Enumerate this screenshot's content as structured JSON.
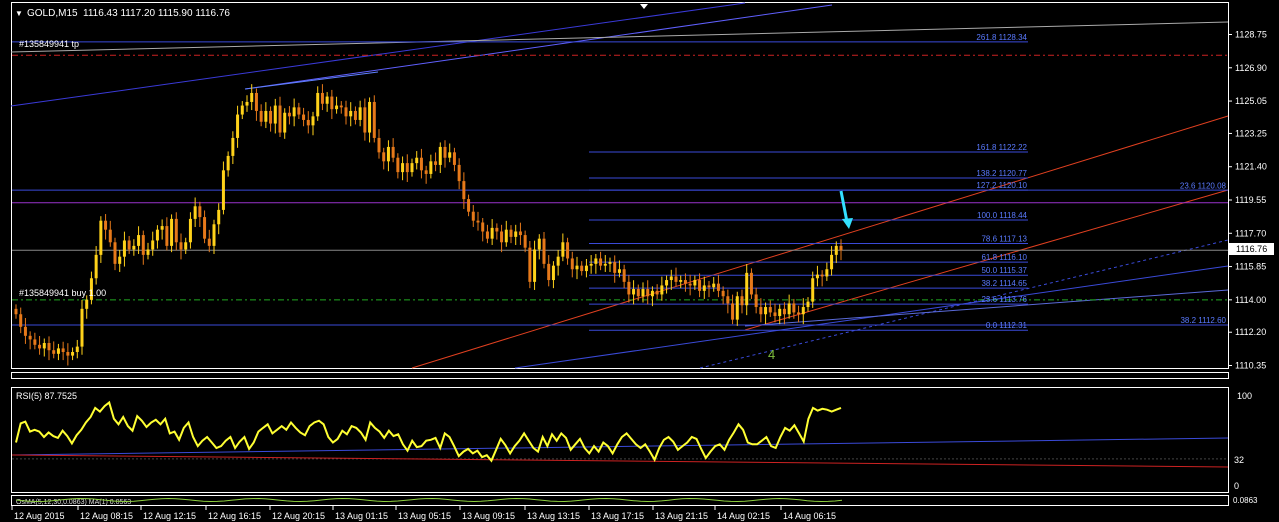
{
  "chart_data": [
    {
      "type": "candlestick",
      "symbol_label": "GOLD,M15",
      "ohlc_label": "1116.43 1117.20 1115.90 1116.76",
      "current_price_label": "1116.76",
      "ylim": [
        1110.35,
        1130.5
      ],
      "price_ticks": [
        "1128.75",
        "1126.90",
        "1125.05",
        "1123.25",
        "1121.40",
        "1119.55",
        "1117.70",
        "1115.85",
        "1114.00",
        "1112.20",
        "1110.35"
      ],
      "orders": [
        {
          "label": "#135849941 tp",
          "price": 1127.6,
          "color": "#cc2222"
        },
        {
          "label": "#135849941 buy 1.00",
          "price": 1114.0,
          "color": "#22aa22"
        }
      ],
      "fib_levels": [
        {
          "label": "261.8 1128.34",
          "price": 1128.34
        },
        {
          "label": "161.8 1122.22",
          "price": 1122.22
        },
        {
          "label": "138.2 1120.77",
          "price": 1120.77
        },
        {
          "label": "127.2 1120.10",
          "price": 1120.1
        },
        {
          "label": "100.0 1118.44",
          "price": 1118.44
        },
        {
          "label": "78.6 1117.13",
          "price": 1117.13
        },
        {
          "label": "61.8 1116.10",
          "price": 1116.1
        },
        {
          "label": "50.0 1115.37",
          "price": 1115.37
        },
        {
          "label": "38.2 1114.65",
          "price": 1114.65
        },
        {
          "label": "23.6 1113.76",
          "price": 1113.76
        },
        {
          "label": "0.0 1112.31",
          "price": 1112.31
        }
      ],
      "right_fib_labels": [
        {
          "label": "23.6 1120.08",
          "price": 1120.08
        },
        {
          "label": "38.2 1112.60",
          "price": 1112.6
        }
      ],
      "wave_label": "4",
      "closes": [
        1113.2,
        1112.5,
        1112.0,
        1111.8,
        1111.5,
        1111.3,
        1111.6,
        1111.2,
        1111.0,
        1111.3,
        1111.1,
        1110.9,
        1111.1,
        1111.4,
        1113.5,
        1114.0,
        1115.2,
        1116.5,
        1118.4,
        1117.9,
        1117.2,
        1116.0,
        1116.4,
        1117.3,
        1116.8,
        1117.0,
        1117.6,
        1116.5,
        1116.8,
        1117.3,
        1117.9,
        1118.1,
        1117.0,
        1118.5,
        1117.2,
        1116.8,
        1117.2,
        1118.5,
        1119.2,
        1118.6,
        1117.4,
        1117.0,
        1118.2,
        1119.0,
        1121.2,
        1122.0,
        1123.0,
        1124.3,
        1124.8,
        1125.0,
        1125.5,
        1124.5,
        1123.9,
        1124.5,
        1123.8,
        1124.8,
        1123.3,
        1124.4,
        1124.2,
        1124.7,
        1124.3,
        1124.0,
        1123.7,
        1124.2,
        1125.5,
        1124.9,
        1125.3,
        1124.6,
        1124.8,
        1124.7,
        1124.2,
        1124.5,
        1124.0,
        1124.7,
        1123.3,
        1125.0,
        1123.0,
        1122.2,
        1121.7,
        1122.5,
        1121.9,
        1121.1,
        1121.6,
        1121.1,
        1121.6,
        1121.9,
        1121.2,
        1121.0,
        1121.7,
        1121.5,
        1122.5,
        1121.9,
        1122.2,
        1121.5,
        1120.6,
        1119.6,
        1118.9,
        1118.4,
        1118.3,
        1117.8,
        1117.4,
        1118.0,
        1117.8,
        1117.2,
        1117.9,
        1117.5,
        1117.8,
        1117.6,
        1116.9,
        1115.0,
        1116.8,
        1117.4,
        1116.0,
        1115.1,
        1115.9,
        1116.4,
        1117.2,
        1116.3,
        1115.7,
        1115.9,
        1115.6,
        1115.9,
        1116.0,
        1116.3,
        1115.9,
        1116.0,
        1116.1,
        1115.5,
        1115.7,
        1115.0,
        1114.3,
        1114.6,
        1114.2,
        1114.6,
        1114.2,
        1114.5,
        1114.3,
        1114.8,
        1115.1,
        1115.3,
        1115.0,
        1115.1,
        1114.9,
        1114.8,
        1115.1,
        1114.5,
        1114.8,
        1114.7,
        1114.9,
        1114.5,
        1114.2,
        1113.8,
        1112.9,
        1114.2,
        1113.7,
        1115.5,
        1114.3,
        1113.6,
        1113.2,
        1113.6,
        1113.3,
        1113.1,
        1113.5,
        1113.2,
        1113.8,
        1113.3,
        1113.2,
        1113.6,
        1113.9,
        1115.2,
        1115.4,
        1115.3,
        1115.7,
        1116.5,
        1117.0,
        1116.76
      ],
      "rsi": {
        "label": "RSI(5) 87.7525",
        "levels": [
          "100",
          "32",
          "0"
        ],
        "values": [
          50,
          71,
          73,
          62,
          64,
          62,
          56,
          61,
          57,
          55,
          63,
          57,
          49,
          58,
          64,
          72,
          78,
          88,
          84,
          90,
          94,
          76,
          70,
          78,
          68,
          63,
          79,
          74,
          67,
          72,
          75,
          70,
          76,
          60,
          62,
          53,
          66,
          72,
          56,
          46,
          52,
          56,
          50,
          44,
          46,
          52,
          56,
          44,
          51,
          56,
          43,
          50,
          62,
          66,
          70,
          60,
          64,
          68,
          64,
          72,
          66,
          61,
          58,
          68,
          72,
          74,
          70,
          56,
          50,
          54,
          63,
          59,
          68,
          66,
          61,
          53,
          72,
          66,
          62,
          55,
          63,
          57,
          59,
          48,
          41,
          52,
          45,
          46,
          52,
          53,
          55,
          44,
          60,
          56,
          46,
          35,
          40,
          43,
          38,
          41,
          34,
          36,
          30,
          42,
          54,
          47,
          38,
          46,
          52,
          60,
          52,
          44,
          40,
          56,
          46,
          59,
          52,
          60,
          55,
          42,
          48,
          54,
          44,
          38,
          46,
          40,
          50,
          46,
          38,
          48,
          56,
          60,
          54,
          48,
          44,
          48,
          40,
          31,
          44,
          53,
          56,
          51,
          42,
          46,
          50,
          56,
          54,
          43,
          33,
          40,
          46,
          48,
          42,
          53,
          61,
          70,
          64,
          50,
          48,
          48,
          52,
          56,
          46,
          44,
          56,
          66,
          63,
          69,
          60,
          51,
          76,
          88,
          85,
          87,
          86,
          84,
          86,
          88
        ]
      },
      "oscillator": {
        "label": "OsMA(5,12,30,0.0863) MA(1) 0.0563",
        "level": "0.0863"
      },
      "time_labels": [
        "12 Aug 2015",
        "12 Aug 08:15",
        "12 Aug 12:15",
        "12 Aug 16:15",
        "12 Aug 20:15",
        "13 Aug 01:15",
        "13 Aug 05:15",
        "13 Aug 09:15",
        "13 Aug 13:15",
        "13 Aug 17:15",
        "13 Aug 21:15",
        "14 Aug 02:15",
        "14 Aug 06:15"
      ]
    }
  ]
}
